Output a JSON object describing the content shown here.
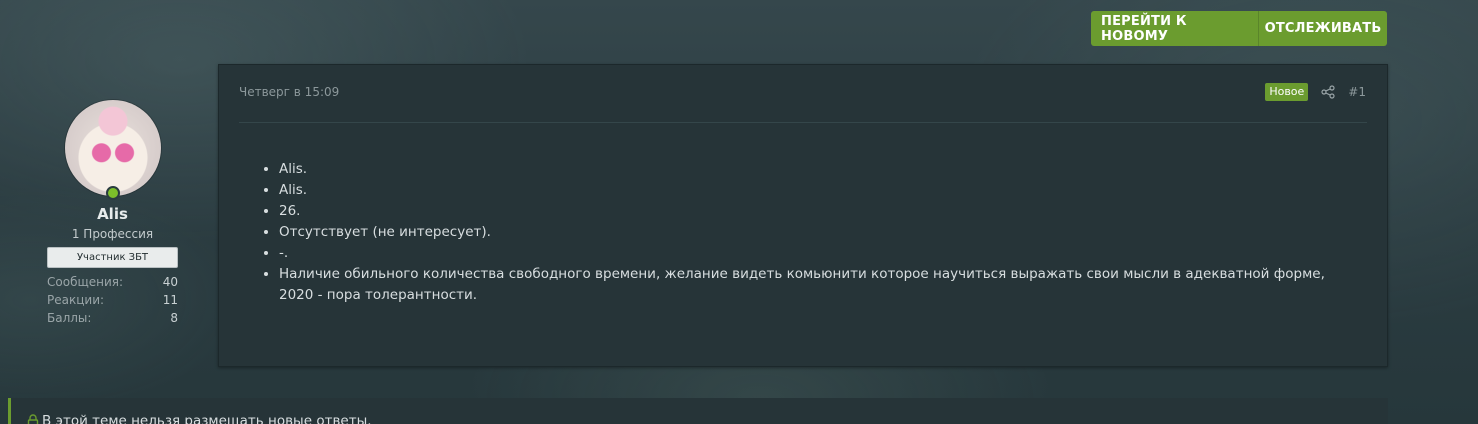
{
  "actions": {
    "go_new": "ПЕРЕЙТИ К НОВОМУ",
    "watch": "ОТСЛЕЖИВАТЬ"
  },
  "user": {
    "name": "Alis",
    "title": "1 Профессия",
    "banner": "Участник ЗБТ",
    "stats": [
      {
        "label": "Сообщения:",
        "value": "40"
      },
      {
        "label": "Реакции:",
        "value": "11"
      },
      {
        "label": "Баллы:",
        "value": "8"
      }
    ]
  },
  "post": {
    "date": "Четверг в 15:09",
    "badge": "Новое",
    "number": "#1",
    "items": [
      "Alis.",
      "Alis.",
      "26.",
      "Отсутствует (не интересует).",
      "-.",
      "Наличие обильного количества свободного времени, желание видеть комьюнити которое научиться выражать свои мысли в адекватной форме, 2020 - пора толерантности."
    ]
  },
  "notice": {
    "text": "В этой теме нельзя размещать новые ответы."
  },
  "colors": {
    "accent": "#6b9c2f",
    "card": "#263438",
    "online": "#7cbf2a"
  },
  "icons": {
    "share": "share-icon",
    "lock": "lock-icon"
  }
}
